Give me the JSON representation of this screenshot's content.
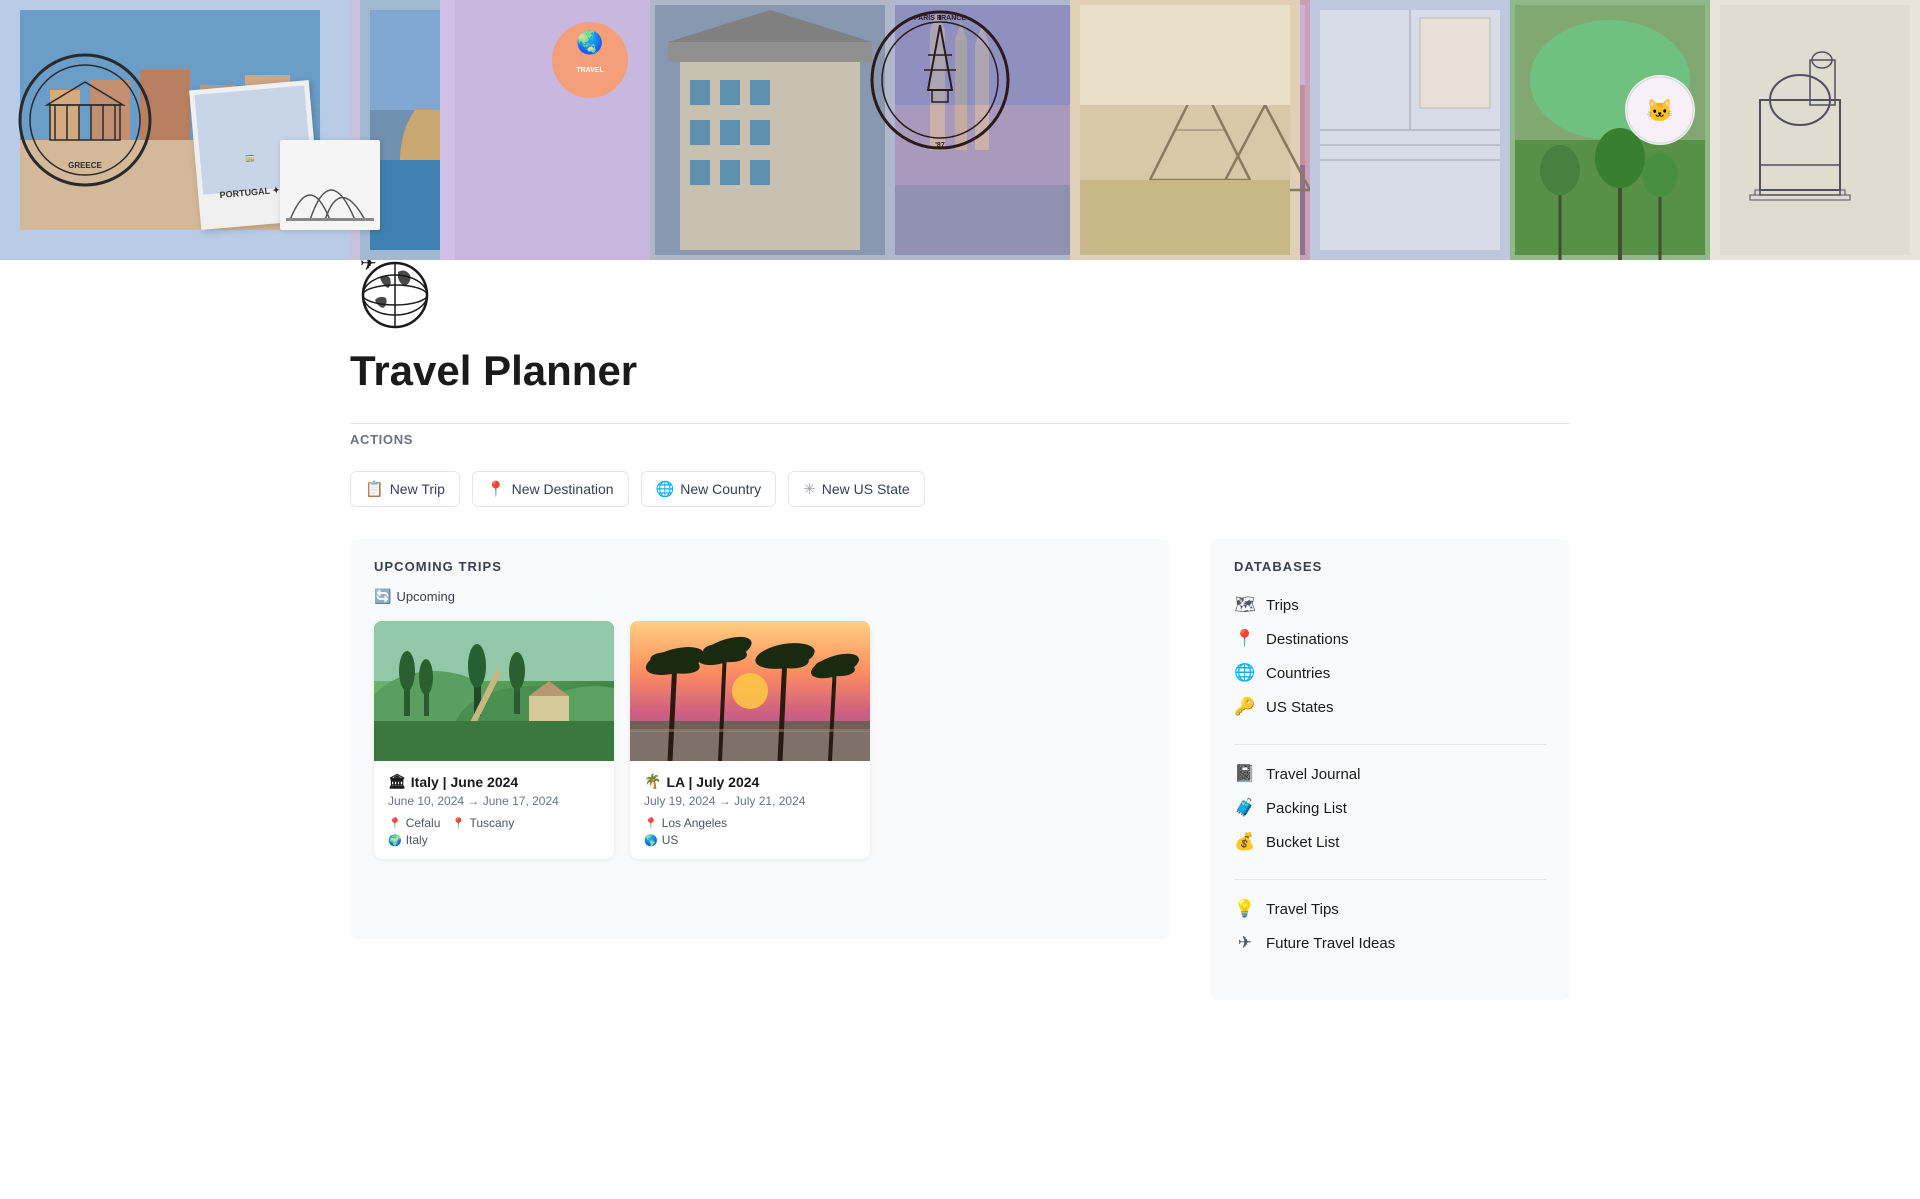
{
  "page": {
    "title": "Travel Planner",
    "icon": "🌍"
  },
  "banner": {
    "alt": "Travel collage banner"
  },
  "actions": {
    "section_label": "ACTIONS",
    "buttons": [
      {
        "id": "new-trip",
        "label": "New Trip",
        "icon": "📋"
      },
      {
        "id": "new-destination",
        "label": "New Destination",
        "icon": "📍"
      },
      {
        "id": "new-country",
        "label": "New Country",
        "icon": "🌐"
      },
      {
        "id": "new-us-state",
        "label": "New US State",
        "icon": "✳"
      }
    ]
  },
  "upcoming_trips": {
    "section_label": "UPCOMING TRIPS",
    "filter_label": "Upcoming",
    "trips": [
      {
        "id": "italy-trip",
        "emoji": "🏛",
        "title": "Italy | June 2024",
        "dates": "June 10, 2024 → June 17, 2024",
        "tags": [
          {
            "icon": "📍",
            "label": "Cefalu"
          },
          {
            "icon": "📍",
            "label": "Tuscany"
          },
          {
            "icon": "🌍",
            "label": "Italy"
          }
        ],
        "bg": "italy"
      },
      {
        "id": "la-trip",
        "emoji": "🌴",
        "title": "LA | July 2024",
        "dates": "July 19, 2024 → July 21, 2024",
        "tags": [
          {
            "icon": "📍",
            "label": "Los Angeles"
          },
          {
            "icon": "🌎",
            "label": "US"
          }
        ],
        "bg": "la"
      }
    ]
  },
  "databases": {
    "section_label": "DATABASES",
    "primary_group": [
      {
        "id": "trips",
        "icon": "🗺",
        "label": "Trips"
      },
      {
        "id": "destinations",
        "icon": "📍",
        "label": "Destinations"
      },
      {
        "id": "countries",
        "icon": "🌐",
        "label": "Countries"
      },
      {
        "id": "us-states",
        "icon": "🔑",
        "label": "US States"
      }
    ],
    "secondary_group": [
      {
        "id": "travel-journal",
        "icon": "📓",
        "label": "Travel Journal"
      },
      {
        "id": "packing-list",
        "icon": "🧳",
        "label": "Packing List"
      },
      {
        "id": "bucket-list",
        "icon": "💰",
        "label": "Bucket List"
      }
    ],
    "tertiary_group": [
      {
        "id": "travel-tips",
        "icon": "💡",
        "label": "Travel Tips"
      },
      {
        "id": "future-travel",
        "icon": "✈",
        "label": "Future Travel Ideas"
      }
    ]
  }
}
